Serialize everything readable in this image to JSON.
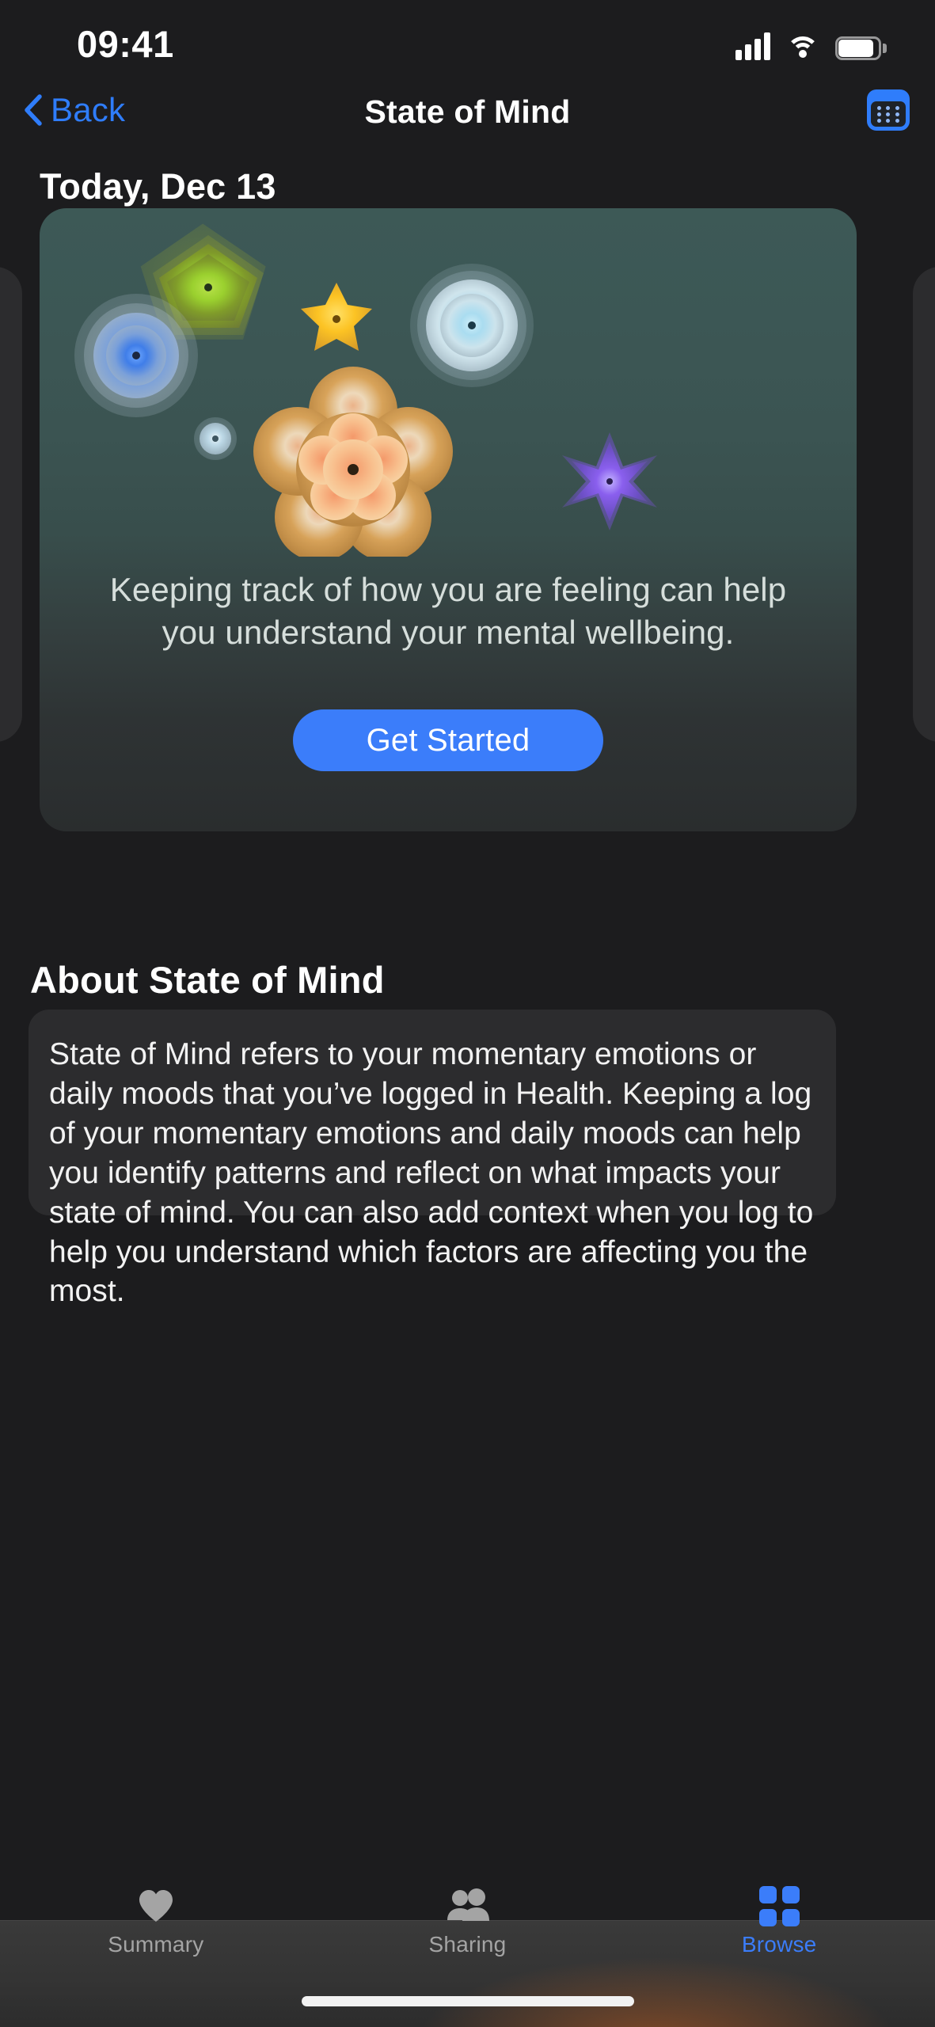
{
  "status_bar": {
    "time": "09:41",
    "cellular_icon": "cellular-bars-icon",
    "wifi_icon": "wifi-icon",
    "battery_icon": "battery-icon"
  },
  "nav": {
    "back_label": "Back",
    "title": "State of Mind",
    "back_icon": "chevron-left-icon",
    "calendar_icon": "calendar-grid-icon",
    "accent_color": "#2f7dfb"
  },
  "main": {
    "date_header": "Today, Dec 13",
    "hero": {
      "description": "Keeping track of how you are feeling can help you understand your mental wellbeing.",
      "cta_label": "Get Started",
      "cta_color": "#3b7dfa",
      "art_name": "state-of-mind-shapes-illustration",
      "shapes": [
        {
          "name": "green-pentagon",
          "color": "#8fc32a"
        },
        {
          "name": "blue-flower",
          "color": "#4f7ef0"
        },
        {
          "name": "yellow-star",
          "color": "#f5c game"
        },
        {
          "name": "light-blue-circle",
          "color": "#aee3f5"
        },
        {
          "name": "orange-flower",
          "color": "#e8a04a"
        },
        {
          "name": "purple-star",
          "color": "#8257e8"
        },
        {
          "name": "small-blue-circle",
          "color": "#b9d8e8"
        }
      ]
    },
    "about": {
      "title": "About State of Mind",
      "body": "State of Mind refers to your momentary emotions or daily moods that you’ve logged in Health. Keeping a log of your momentary emotions and daily moods can help you identify patterns and reflect on what impacts your state of mind. You can also add context when you log to help you understand which factors are affecting you the most."
    }
  },
  "tab_bar": {
    "items": [
      {
        "label": "Summary",
        "icon": "heart-icon",
        "active": false
      },
      {
        "label": "Sharing",
        "icon": "people-icon",
        "active": false
      },
      {
        "label": "Browse",
        "icon": "grid-icon",
        "active": true
      }
    ],
    "active_color": "#3b7dfa",
    "inactive_color": "#a4a4a4"
  }
}
